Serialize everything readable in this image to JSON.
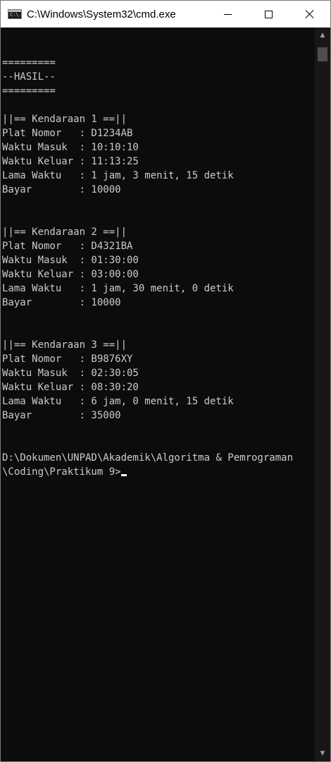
{
  "window": {
    "title": "C:\\Windows\\System32\\cmd.exe",
    "icon_glyph": "C:\\."
  },
  "icons": {
    "app": "cmd-icon",
    "minimize": "minimize-icon",
    "maximize": "maximize-icon",
    "close": "close-icon",
    "scroll_up": "chevron-up-icon",
    "scroll_down": "chevron-down-icon"
  },
  "scrollbar": {
    "up_glyph": "▲",
    "down_glyph": "▼"
  },
  "colors": {
    "console_bg": "#0c0c0c",
    "console_text": "#cccccc",
    "titlebar_bg": "#ffffff"
  },
  "console": {
    "text": "=========\n--HASIL--\n=========\n\n||== Kendaraan 1 ==||\nPlat Nomor   : D1234AB\nWaktu Masuk  : 10:10:10\nWaktu Keluar : 11:13:25\nLama Waktu   : 1 jam, 3 menit, 15 detik\nBayar        : 10000\n\n\n||== Kendaraan 2 ==||\nPlat Nomor   : D4321BA\nWaktu Masuk  : 01:30:00\nWaktu Keluar : 03:00:00\nLama Waktu   : 1 jam, 30 menit, 0 detik\nBayar        : 10000\n\n\n||== Kendaraan 3 ==||\nPlat Nomor   : B9876XY\nWaktu Masuk  : 02:30:05\nWaktu Keluar : 08:30:20\nLama Waktu   : 6 jam, 0 menit, 15 detik\nBayar        : 35000\n\n\nD:\\Dokumen\\UNPAD\\Akademik\\Algoritma & Pemrograman\n\\Coding\\Praktikum 9>"
  }
}
